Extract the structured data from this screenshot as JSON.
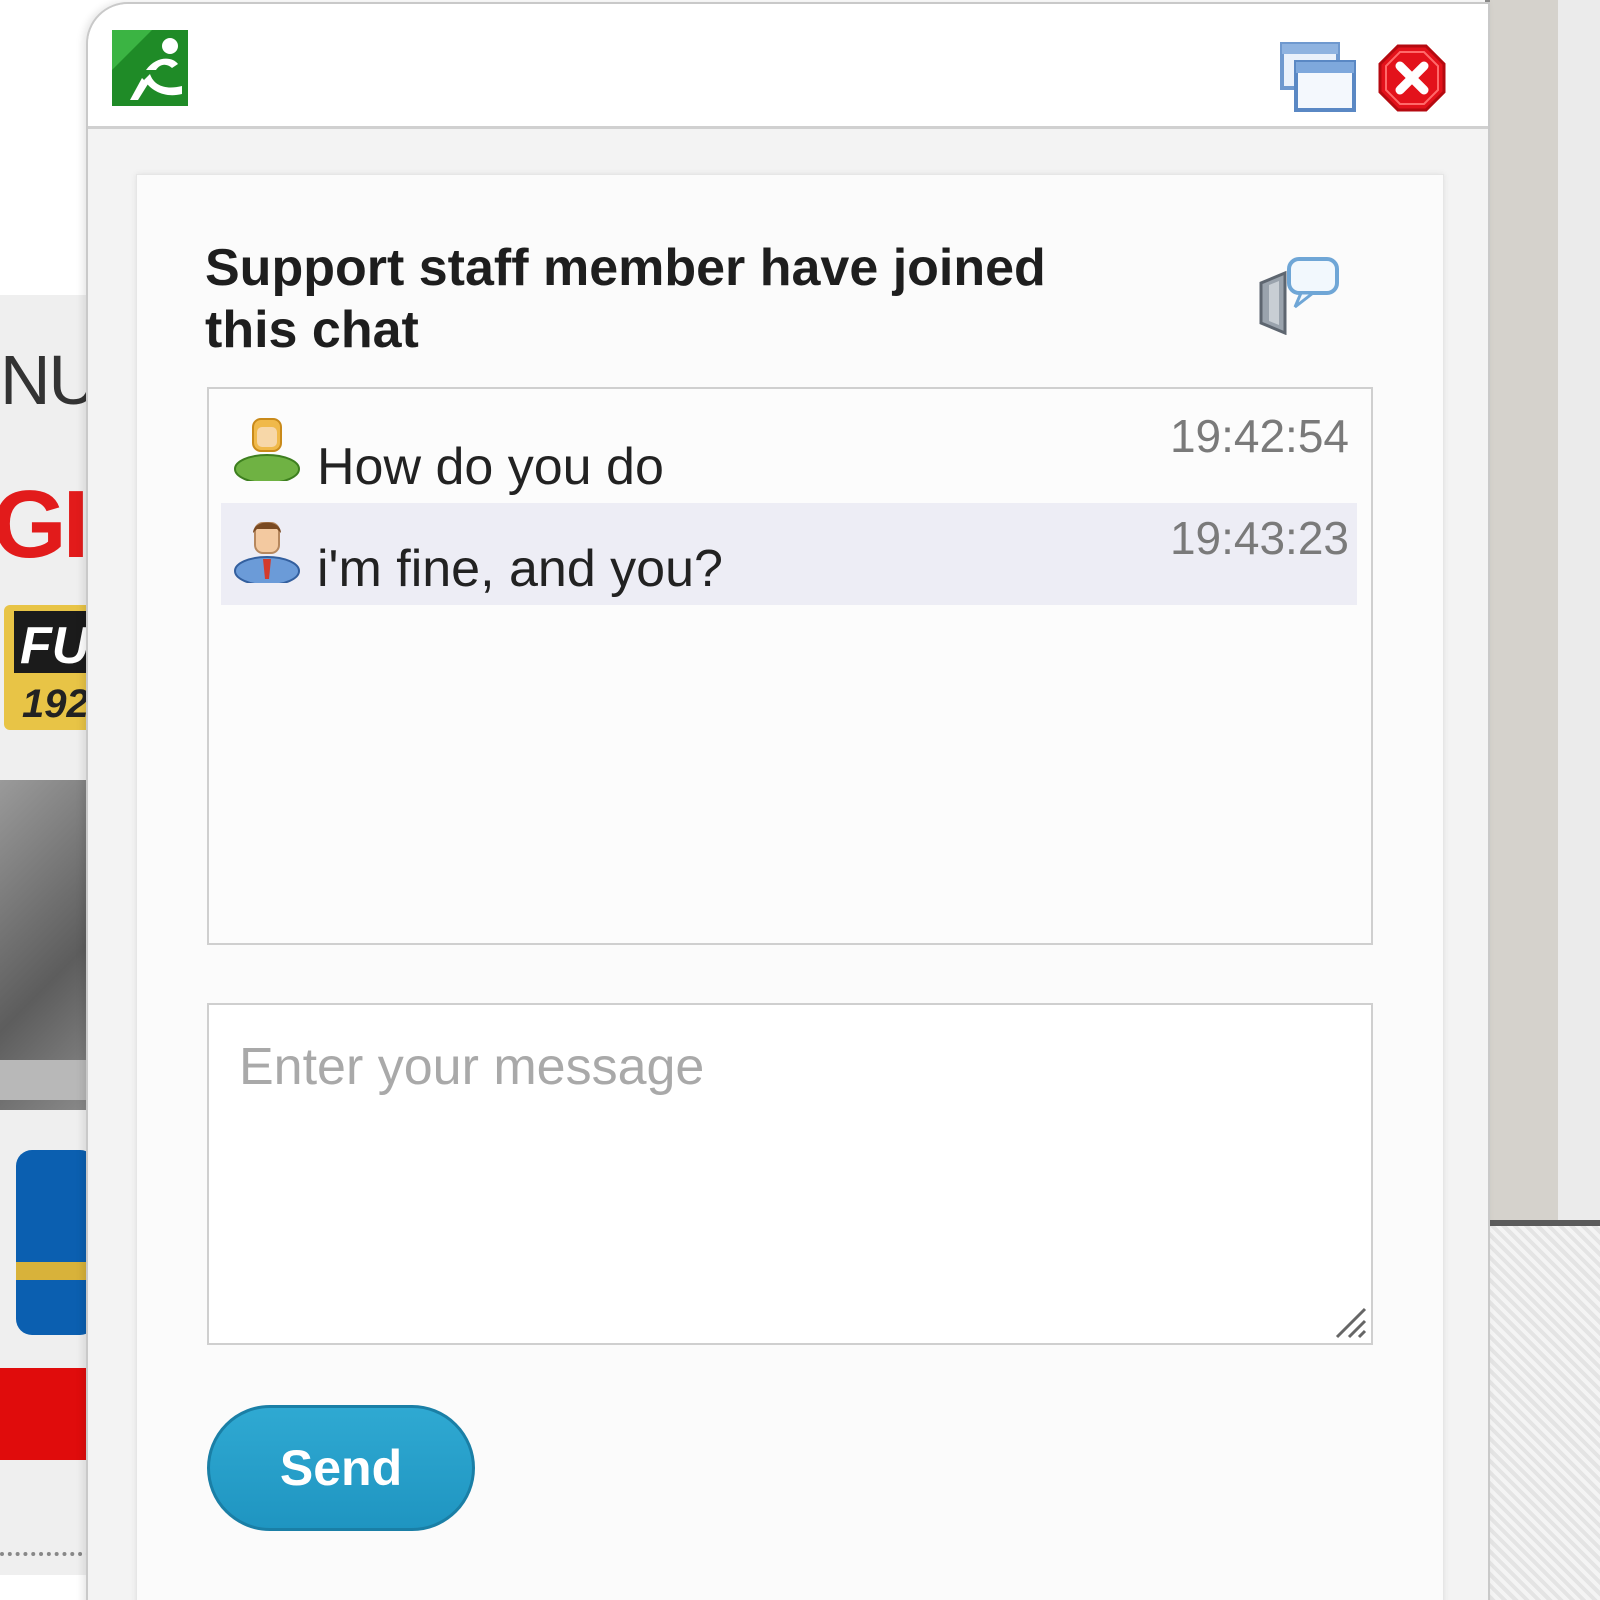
{
  "background": {
    "fragment_nu": "NU",
    "fragment_gia": "GIA",
    "badge_text": "FU",
    "badge_number": "192"
  },
  "chat_window": {
    "status_title": "Support staff member have joined this chat",
    "messages": [
      {
        "text": "How do you do",
        "time": "19:42:54",
        "sender": "visitor"
      },
      {
        "text": "i'm fine, and you?",
        "time": "19:43:23",
        "sender": "operator"
      }
    ],
    "input": {
      "value": "",
      "placeholder": "Enter your message"
    },
    "send_label": "Send"
  },
  "icons": {
    "logo": "app-logo-icon",
    "restore": "restore-window-icon",
    "close": "close-icon",
    "status": "chat-status-icon",
    "visitor_avatar": "user-avatar-icon",
    "operator_avatar": "operator-avatar-icon"
  },
  "colors": {
    "accent": "#2ba6cf",
    "close_red": "#e3121b",
    "logo_green": "#1f8b27",
    "alt_row": "#ededf5"
  }
}
